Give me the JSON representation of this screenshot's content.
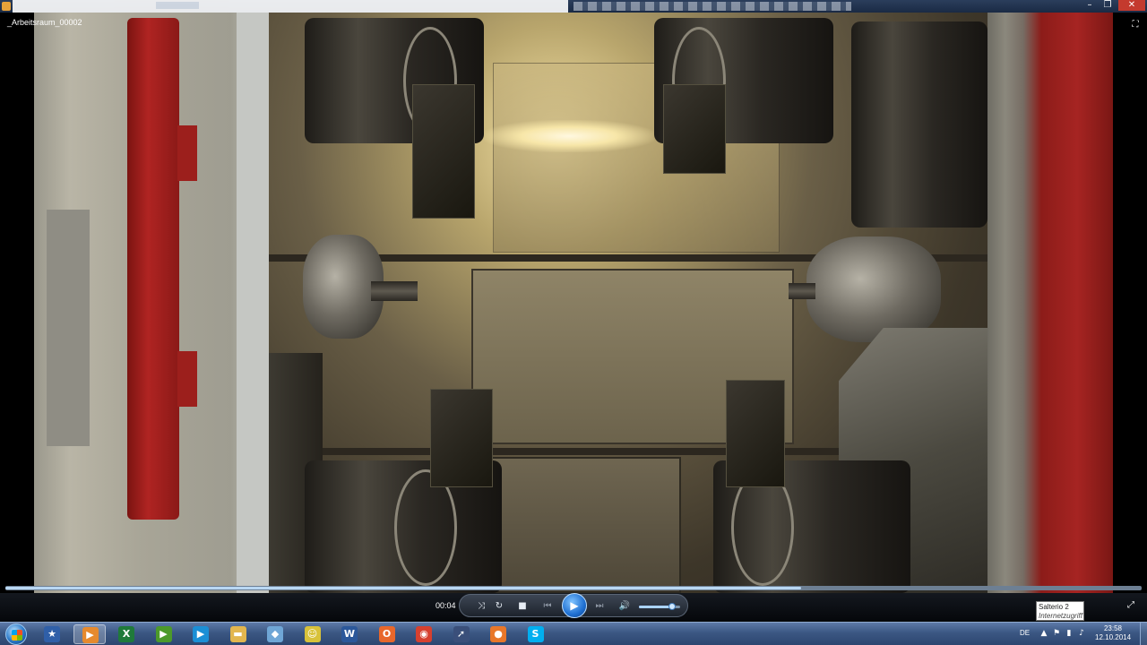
{
  "window": {
    "minimize_glyph": "–",
    "restore_glyph": "❐",
    "close_glyph": "✕"
  },
  "video": {
    "title": "_Arbeitsraum_00002",
    "fullscreen_glyph": "⛶",
    "progress_fraction": 0.7
  },
  "player": {
    "time": "00:04",
    "buttons": {
      "shuffle": "⤨",
      "repeat": "↻",
      "stop": "■",
      "previous": "⏮",
      "play": "▶",
      "next": "⏭",
      "volume": "🔊"
    },
    "volume_fraction": 0.8,
    "switch_to_compact_glyph": "⤢"
  },
  "tooltip": {
    "line1": "Salterio  2",
    "line2": "Internetzugriff"
  },
  "taskbar": {
    "apps": [
      {
        "name": "start-menu-icon",
        "glyph": "",
        "color": "#2a79c9"
      },
      {
        "name": "star-app-icon",
        "glyph": "★",
        "color": "#2f5fa8"
      },
      {
        "name": "media-player-icon",
        "glyph": "▶",
        "color": "#e68a2e"
      },
      {
        "name": "excel-icon",
        "glyph": "X",
        "color": "#1f7a3a"
      },
      {
        "name": "green-app-icon",
        "glyph": "▶",
        "color": "#4c9a2a"
      },
      {
        "name": "play-app-icon",
        "glyph": "▶",
        "color": "#1b8fd6"
      },
      {
        "name": "folder-icon",
        "glyph": "▬",
        "color": "#e2b64f"
      },
      {
        "name": "diamond-app-icon",
        "glyph": "◆",
        "color": "#6fa6d6"
      },
      {
        "name": "smiley-app-icon",
        "glyph": "☺",
        "color": "#d8c23a"
      },
      {
        "name": "word-icon",
        "glyph": "W",
        "color": "#2b579a"
      },
      {
        "name": "office-app-icon",
        "glyph": "O",
        "color": "#e8672b"
      },
      {
        "name": "chrome-icon",
        "glyph": "◉",
        "color": "#d6402f"
      },
      {
        "name": "arrow-app-icon",
        "glyph": "➚",
        "color": "#3a4f7a"
      },
      {
        "name": "firefox-icon",
        "glyph": "●",
        "color": "#e8772a"
      },
      {
        "name": "skype-icon",
        "glyph": "S",
        "color": "#00aff0"
      }
    ],
    "language": "DE",
    "clock_time": "23:58",
    "clock_date": "12.10.2014",
    "tray_icons": [
      "▲",
      "⚑",
      "▮",
      "♪"
    ]
  }
}
